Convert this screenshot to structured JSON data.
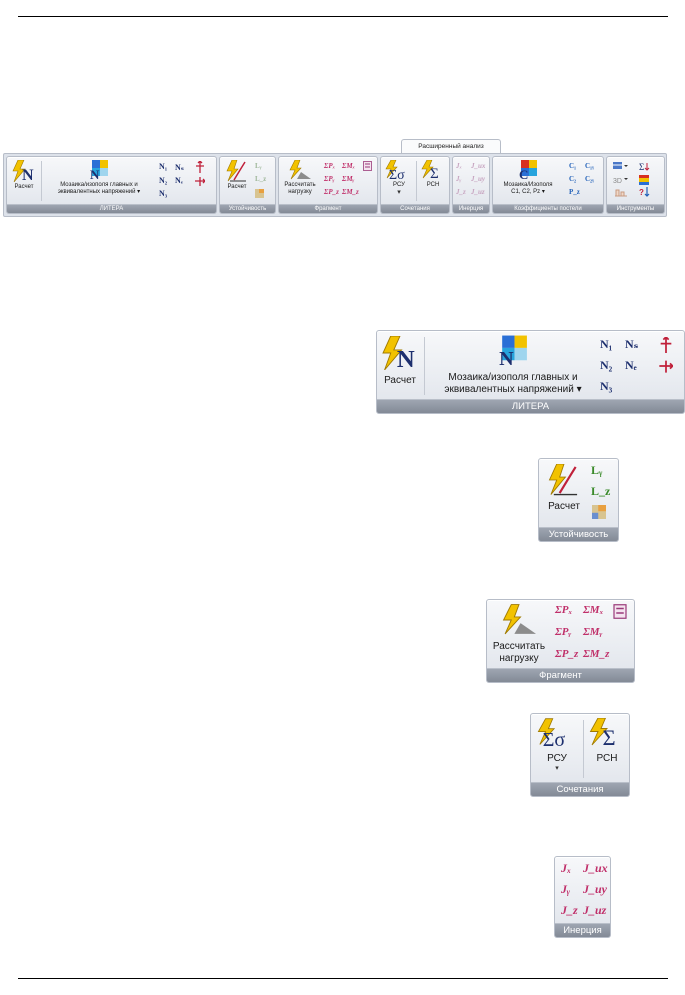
{
  "ribbon": {
    "tab_label": "Расширенный анализ",
    "litera": {
      "caption": "ЛИТЕРА",
      "calc_label": "Расчет",
      "mosaic_label_1": "Мозаика/изополя главных и",
      "mosaic_label_2": "эквивалентных напряжений",
      "n_symbols": [
        "N₁",
        "Nₛ",
        "N₂",
        "Nₑ",
        "N₃"
      ]
    },
    "stability": {
      "caption": "Устойчивость",
      "calc_label": "Расчет",
      "ly": "Lᵧ",
      "lz": "L_z"
    },
    "fragment": {
      "caption": "Фрагмент",
      "calc_label_1": "Рассчитать",
      "calc_label_2": "нагрузку",
      "sums": [
        "ΣPₓ",
        "ΣMₓ",
        "ΣPᵧ",
        "ΣMᵧ",
        "ΣP_z",
        "ΣM_z"
      ]
    },
    "combinations": {
      "caption": "Сочетания",
      "rsu_label": "РСУ",
      "rsn_label": "РСН"
    },
    "inertia": {
      "caption": "Инерция",
      "symbols": [
        "Jₓ",
        "J_ux",
        "Jᵧ",
        "J_uy",
        "J_z",
        "J_uz"
      ]
    },
    "bedding": {
      "caption": "Коэффициенты постели",
      "mosaic_label_1": "Мозаика/Изополя",
      "mosaic_label_2": "C1, C2, Pz",
      "symbols": [
        "C₁",
        "C₁ᵧ",
        "C₂",
        "C₂ᵧ",
        "P_z"
      ]
    },
    "tools": {
      "caption": "Инструменты"
    }
  },
  "colors": {
    "caption_bg": "#8d94a0",
    "panel_bg": "#e9ecf1",
    "bolt": "#f2c200",
    "pink_symbol": "#c0306a",
    "green_symbol": "#3a8a2a",
    "navy_symbol": "#1d2f6e",
    "blue_symbol": "#1f5fb8"
  }
}
